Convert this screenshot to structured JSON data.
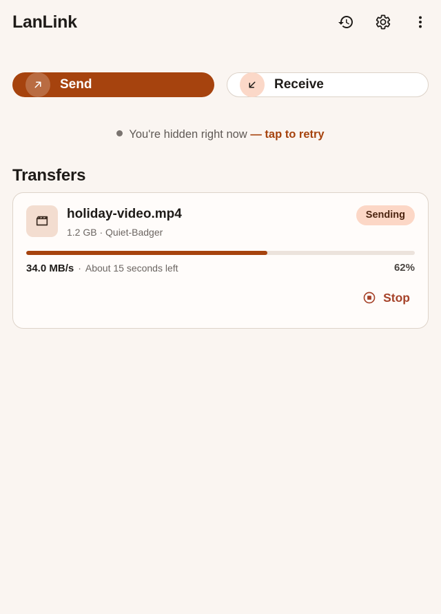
{
  "app": {
    "title": "LanLink"
  },
  "top_bar": {
    "icons": [
      "history-icon",
      "settings-gear-icon",
      "more-vert-icon"
    ]
  },
  "mode": {
    "send_label": "Send",
    "receive_label": "Receive",
    "send_icon": "arrow-up-right-icon",
    "receive_icon": "arrow-down-left-icon",
    "active": "Send"
  },
  "visibility": {
    "message": "You're hidden right now",
    "action": "— tap to retry"
  },
  "transfers": {
    "title": "Transfers",
    "items": [
      {
        "icon": "movie-icon",
        "file_name": "holiday-video.mp4",
        "meta": "1.2 GB · Quiet-Badger",
        "status": "Sending",
        "speed": "34.0 MB/s",
        "separator": "·",
        "eta": "About 15 seconds left",
        "progress": 62,
        "percent_label": "62%",
        "stop_label": "Stop"
      }
    ]
  },
  "colors": {
    "accent": "#a6430e",
    "background": "#faf5f1",
    "badge": "#fcd7c6",
    "stop": "#a6432a"
  }
}
